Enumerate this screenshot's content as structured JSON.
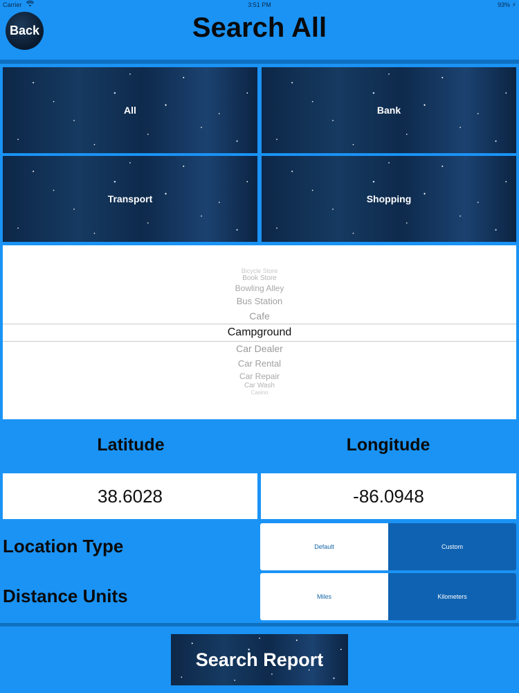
{
  "status_bar": {
    "carrier": "Carrier",
    "wifi_icon": "wifi-icon",
    "time": "3:51 PM",
    "battery": "93% ⚡"
  },
  "header": {
    "back_label": "Back",
    "title": "Search All"
  },
  "categories": [
    {
      "label": "All"
    },
    {
      "label": "Bank"
    },
    {
      "label": "Transport"
    },
    {
      "label": "Shopping"
    }
  ],
  "picker": {
    "items": [
      "Bicycle Store",
      "Book Store",
      "Bowling Alley",
      "Bus Station",
      "Cafe",
      "Campground",
      "Car Dealer",
      "Car Rental",
      "Car Repair",
      "Car Wash",
      "Casino"
    ],
    "selected": "Campground"
  },
  "coordinates": {
    "latitude_label": "Latitude",
    "longitude_label": "Longitude",
    "latitude_value": "38.6028",
    "longitude_value": "-86.0948"
  },
  "location_type": {
    "label": "Location Type",
    "options": [
      "Default",
      "Custom"
    ],
    "selected": "Custom"
  },
  "distance_units": {
    "label": "Distance Units",
    "options": [
      "Miles",
      "Kilometers"
    ],
    "selected": "Kilometers"
  },
  "footer": {
    "search_label": "Search Report"
  },
  "colors": {
    "background": "#1a93f5",
    "divider": "#0f6fc0",
    "segment_active": "#0f62b1"
  }
}
